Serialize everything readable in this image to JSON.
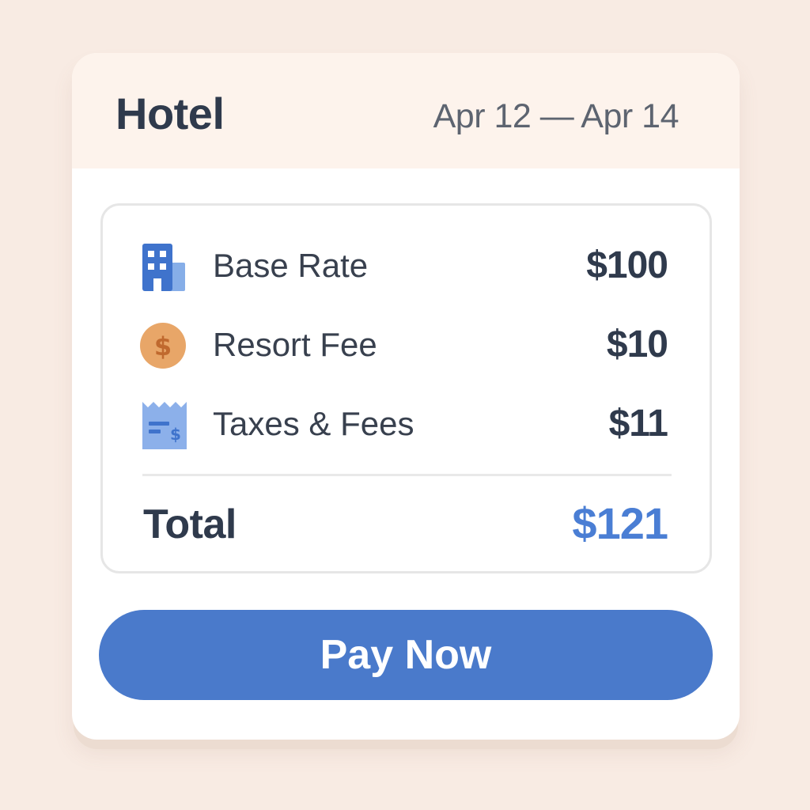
{
  "header": {
    "title": "Hotel",
    "date_range": "Apr 12 — Apr 14"
  },
  "line_items": [
    {
      "icon": "building-icon",
      "label": "Base Rate",
      "amount": "$100"
    },
    {
      "icon": "dollar-coin-icon",
      "label": "Resort Fee",
      "amount": "$10"
    },
    {
      "icon": "receipt-icon",
      "label": "Taxes & Fees",
      "amount": "$11"
    }
  ],
  "total": {
    "label": "Total",
    "amount": "$121"
  },
  "pay_button": {
    "label": "Pay Now"
  },
  "colors": {
    "page_background": "#f8ebe3",
    "header_background": "#fdf3ec",
    "accent": "#4a7acb",
    "total_amount": "#4a7ed4",
    "coin": "#e8a668",
    "text_dark": "#2f3a4c"
  }
}
